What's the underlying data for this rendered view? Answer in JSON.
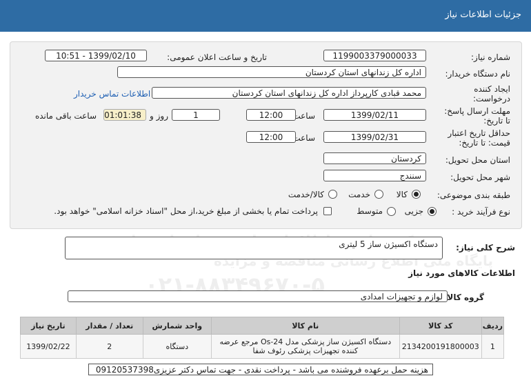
{
  "header": {
    "title": "جزئیات اطلاعات نیاز"
  },
  "form": {
    "need_number": {
      "label": "شماره نیاز:",
      "value": "1199003379000033"
    },
    "announce": {
      "label": "تاریخ و ساعت اعلان عمومی:",
      "value": "1399/02/10 - 10:51"
    },
    "buyer_org": {
      "label": "نام دستگاه خریدار:",
      "value": "اداره کل زندانهای استان کردستان"
    },
    "creator": {
      "label_line1": "ایجاد کننده",
      "label_line2": "درخواست:",
      "value": "محمد  قبادی کارپرداز اداره کل زندانهای استان کردستان",
      "contact_link": "اطلاعات تماس خریدار"
    },
    "reply_deadline": {
      "label_line1": "مهلت ارسال پاسخ:",
      "label_line2": "تا تاریخ:",
      "date": "1399/02/11",
      "time_label": "ساعت",
      "time": "12:00",
      "days": "1",
      "days_label": "روز و",
      "remaining": "01:01:38",
      "remaining_label": "ساعت باقی مانده"
    },
    "price_validity": {
      "label_line1": "حداقل تاریخ اعتبار",
      "label_line2": "قیمت: تا تاریخ:",
      "date": "1399/02/31",
      "time_label": "ساعت",
      "time": "12:00"
    },
    "province": {
      "label": "استان محل تحویل:",
      "value": "کردستان"
    },
    "city": {
      "label": "شهر محل تحویل:",
      "value": "سنندج"
    },
    "category": {
      "label": "طبقه بندی موضوعی:",
      "options": [
        "کالا",
        "خدمت",
        "کالا/خدمت"
      ],
      "selected": "کالا"
    },
    "purchase_type": {
      "label": "نوع فرآیند خرید :",
      "options": [
        "جزیی",
        "متوسط"
      ],
      "selected": "جزیی",
      "checkbox_text": "پرداخت تمام یا بخشی از مبلغ خرید،از محل \"اسناد خزانه اسلامی\" خواهد بود."
    }
  },
  "description": {
    "label": "شرح کلی نیاز:",
    "value": "دستگاه اکسیژن ساز 5 لیتری"
  },
  "goods_info_title": "اطلاعات کالاهای مورد نیاز",
  "goods_group": {
    "label": "گروه کالا:",
    "value": "لوازم و تجهیزات امدادی"
  },
  "table": {
    "headers": [
      "ردیف",
      "کد کالا",
      "نام کالا",
      "واحد شمارش",
      "تعداد / مقدار",
      "تاریخ نیاز"
    ],
    "rows": [
      {
        "row": "1",
        "code": "2134200191800003",
        "name": "دستگاه اکسیژن ساز پزشکی مدل Os-24 مرجع عرضه کننده تجهیزات پزشکی رئوف شفا",
        "unit": "دستگاه",
        "qty": "2",
        "date": "1399/02/22"
      }
    ]
  },
  "note": "هزینه حمل برعهده فروشنده می باشد - پرداخت نقدی - جهت تماس  دکتر عزیزی09120537398",
  "watermark": {
    "line1": "پایگاه ملی اطلاع رسانی مناقصه و مزایده",
    "line2": "۰۲۱-۸۸۳۴۹۶۷۰-۵",
    "line3": "مرکز فناوری اطلاعات پارس نماد داده ها"
  }
}
